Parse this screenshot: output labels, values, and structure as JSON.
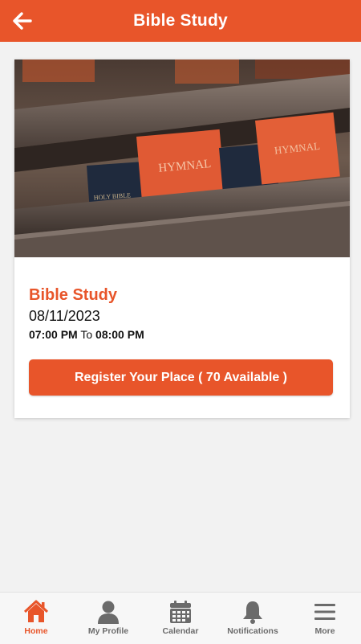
{
  "header": {
    "title": "Bible Study",
    "back_icon": "arrow-left-icon"
  },
  "event": {
    "image_description_icon": "hymnal-books-photo",
    "title": "Bible Study",
    "date": "08/11/2023",
    "start_time": "07:00 PM",
    "time_separator": "To",
    "end_time": "08:00 PM",
    "register_label": "Register Your Place ( 70 Available )"
  },
  "tabs": [
    {
      "label": "Home",
      "icon": "home-icon",
      "active": true
    },
    {
      "label": "My Profile",
      "icon": "user-icon",
      "active": false
    },
    {
      "label": "Calendar",
      "icon": "calendar-icon",
      "active": false
    },
    {
      "label": "Notifications",
      "icon": "bell-icon",
      "active": false
    },
    {
      "label": "More",
      "icon": "menu-icon",
      "active": false
    }
  ],
  "colors": {
    "accent": "#e8552a",
    "inactive": "#6b6b6b",
    "background": "#f2f2f2"
  }
}
